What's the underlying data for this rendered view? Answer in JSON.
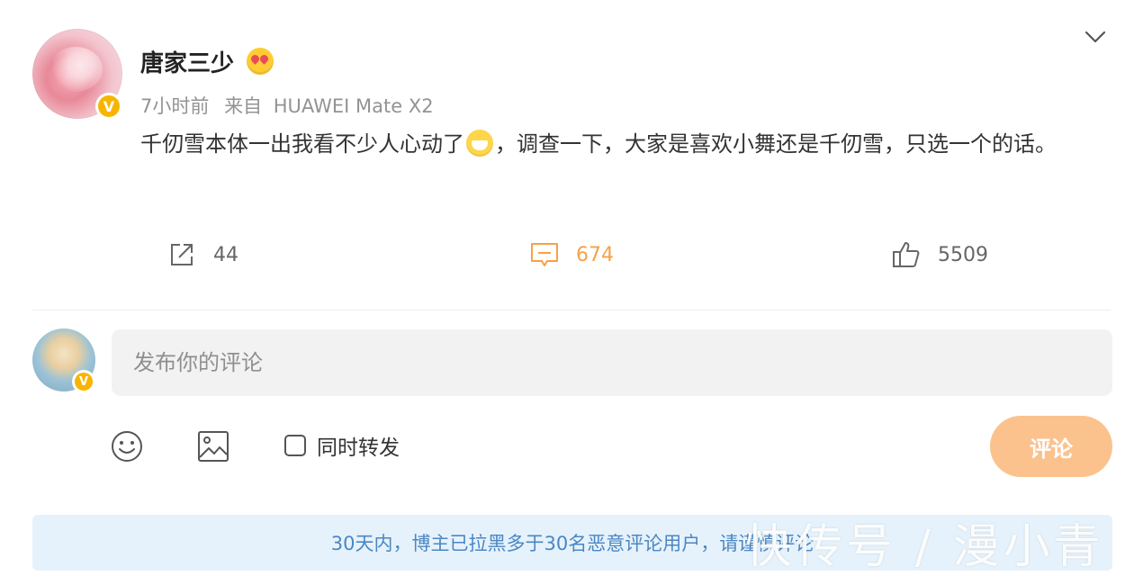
{
  "post": {
    "username": "唐家三少",
    "time": "7小时前",
    "source_prefix": "来自",
    "device": "HUAWEI Mate X2",
    "text_part1": "千仞雪本体一出我看不少人心动了",
    "text_part2": "，调查一下，大家是喜欢小舞还是千仞雪，只选一个的话。",
    "badge_icon": "heart-eyes-emoji-icon",
    "inline_emoji": "grinning-mask-emoji-icon"
  },
  "actions": {
    "share_count": "44",
    "comment_count": "674",
    "like_count": "5509"
  },
  "composer": {
    "placeholder": "发布你的评论",
    "repost_label": "同时转发",
    "submit_label": "评论"
  },
  "notice": {
    "text": "30天内，博主已拉黑多于30名恶意评论用户，请谨慎评论"
  },
  "watermark": {
    "text": "快传号 / 漫小青"
  },
  "colors": {
    "accent_orange": "#f6a149",
    "submit_bg": "#fbc28e",
    "verified": "#f8b500",
    "notice_bg": "#e6f2fb",
    "notice_text": "#4a87c4"
  }
}
